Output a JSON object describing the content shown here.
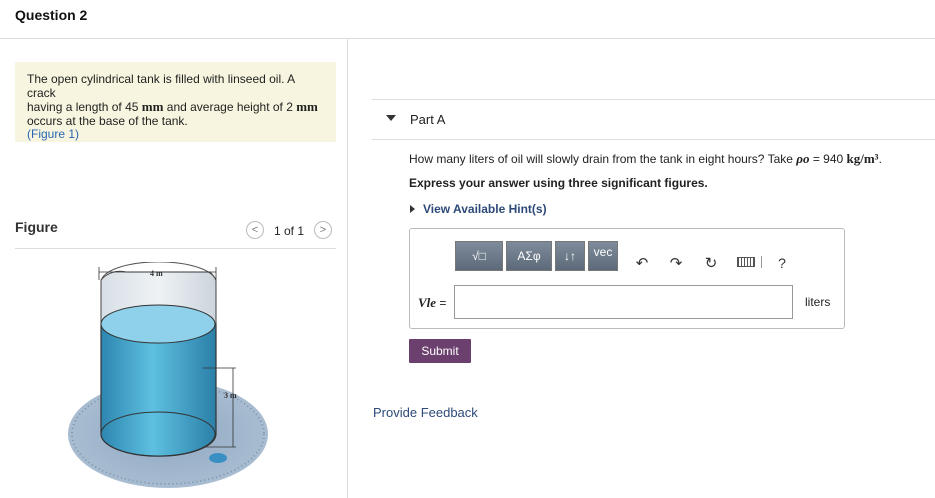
{
  "question": {
    "title": "Question 2"
  },
  "problem": {
    "text_1": "The open cylindrical tank is filled with linseed oil. A crack",
    "text_2a": "having a length of 45 ",
    "unit_mm": "mm",
    "text_2b": " and average height of 2 ",
    "text_3": "occurs at the base of the tank.",
    "figure_link": "(Figure 1)"
  },
  "figure": {
    "label": "Figure",
    "pager": "1 of 1",
    "prev": "<",
    "next": ">",
    "dim_width": "4 m",
    "dim_height": "3 m"
  },
  "partA": {
    "label": "Part A",
    "question_pre": "How many liters of oil will slowly drain from the tank in eight hours? Take ",
    "rho": "ρo",
    "question_eq": " = 940 ",
    "question_unit": "kg/m³",
    "question_end": ".",
    "instruction": "Express your answer using three significant figures.",
    "hint": "View Available Hint(s)",
    "toolbar": {
      "templates": "√□",
      "greek": "ΑΣφ",
      "arrows": "↓↑",
      "vec": "vec",
      "help": "?"
    },
    "icons": [
      "templates-icon",
      "undo-icon",
      "redo-icon",
      "reset-icon",
      "keyboard-icon",
      "help-icon"
    ],
    "variable": "Vle",
    "equals": "=",
    "input_value": "",
    "units": "liters",
    "submit": "Submit"
  },
  "feedback": "Provide Feedback",
  "colors": {
    "submit": "#6b3f6e",
    "problem_bg": "#f7f5df",
    "link": "#2a66b3"
  }
}
